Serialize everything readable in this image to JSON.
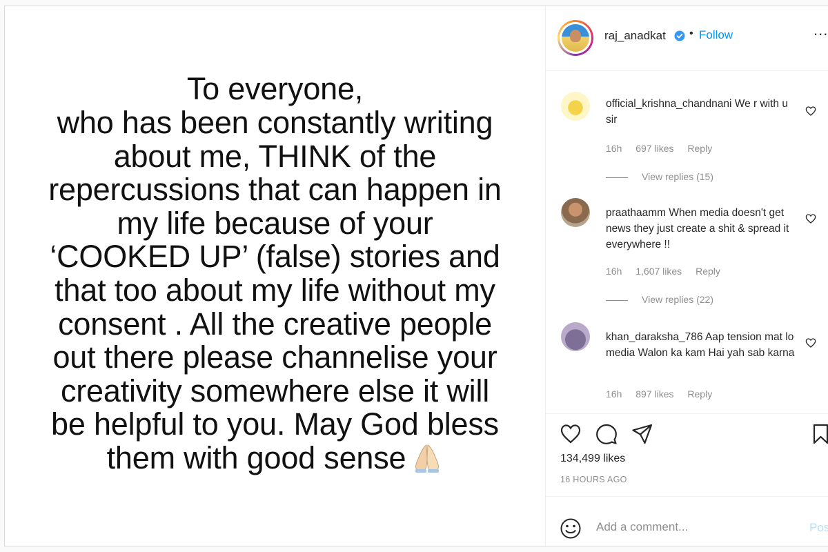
{
  "post": {
    "lines": [
      "To everyone,",
      "who has been constantly writing",
      "about me, THINK of the",
      "repercussions that can happen in",
      "my life because of your",
      "‘COOKED UP’ (false) stories and",
      "that too about my life without my",
      "consent . All the creative people",
      "out there please channelise your",
      "creativity somewhere else it will",
      "be helpful to you. May God bless",
      "them with good sense"
    ]
  },
  "header": {
    "username": "raj_anadkat",
    "separator": "•",
    "follow_label": "Follow",
    "more_label": "..."
  },
  "comments": [
    {
      "user": "official_krishna_chandnani",
      "text": "We r with u sir",
      "time": "16h",
      "likes": "697 likes",
      "reply": "Reply",
      "view_replies": "View replies (15)"
    },
    {
      "user": "praathaamm",
      "text": "When media doesn't get news they just create a shit & spread it everywhere !!",
      "time": "16h",
      "likes": "1,607 likes",
      "reply": "Reply",
      "view_replies": "View replies (22)"
    },
    {
      "user": "khan_daraksha_786",
      "text": "Aap tension mat lo media Walon ka kam Hai yah sab karna",
      "time": "16h",
      "likes": "897 likes",
      "reply": "Reply"
    }
  ],
  "footer": {
    "likes": "134,499 likes",
    "time": "16 HOURS AGO",
    "comment_placeholder": "Add a comment...",
    "post_label": "Pos"
  },
  "colors": {
    "accent": "#0095f6",
    "muted": "#8e8e8e",
    "border": "#efefef"
  }
}
